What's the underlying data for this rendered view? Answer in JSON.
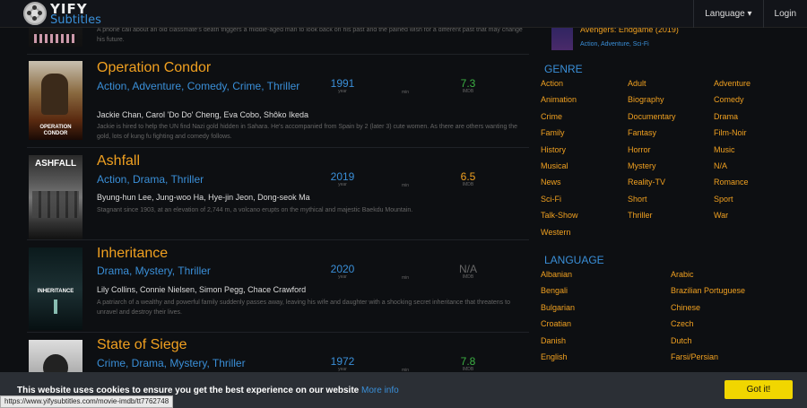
{
  "header": {
    "logo_line1": "YIFY",
    "logo_line2": "Subtitles",
    "nav": [
      "Language ▾",
      "Login"
    ]
  },
  "top_desc": "A phone call about an old classmate's death triggers a middle-aged man to look back on his past and the pained wish for a different past that may change his future.",
  "movies": [
    {
      "title": "Operation Condor",
      "genres": "Action, Adventure, Comedy, Crime, Thriller",
      "cast": "Jackie Chan, Carol 'Do Do' Cheng, Eva Cobo, Shôko Ikeda",
      "desc": "Jackie is hired to help the UN find Nazi gold hidden in Sahara. He's accompanied from Spain by 2 (later 3) cute women. As there are others wanting the gold, lots of kung fu fighting and comedy follows.",
      "year": "1991",
      "min": "",
      "imdb": "7.3",
      "poster_text": "OPERATION CONDOR",
      "imdb_color": "#3cb043"
    },
    {
      "title": "Ashfall",
      "genres": "Action, Drama, Thriller",
      "cast": "Byung-hun Lee, Jung-woo Ha, Hye-jin Jeon, Dong-seok Ma",
      "desc": "Stagnant since 1903, at an elevation of 2,744 m, a volcano erupts on the mythical and majestic Baekdu Mountain.",
      "year": "2019",
      "min": "",
      "imdb": "6.5",
      "poster_text": "ASHFALL",
      "imdb_color": "#f0a020"
    },
    {
      "title": "Inheritance",
      "genres": "Drama, Mystery, Thriller",
      "cast": "Lily Collins, Connie Nielsen, Simon Pegg, Chace Crawford",
      "desc": "A patriarch of a wealthy and powerful family suddenly passes away, leaving his wife and daughter with a shocking secret inheritance that threatens to unravel and destroy their lives.",
      "year": "2020",
      "min": "",
      "imdb": "N/A",
      "poster_text": "INHERITANCE",
      "imdb_color": "#666666"
    },
    {
      "title": "State of Siege",
      "genres": "Crime, Drama, Mystery, Thriller",
      "cast": "",
      "desc": "",
      "year": "1972",
      "min": "",
      "imdb": "7.8",
      "poster_text": "",
      "imdb_color": "#3cb043"
    }
  ],
  "stat_labels": {
    "year": "year",
    "min": "min",
    "imdb": "IMDB"
  },
  "sidebar": {
    "featured_title": "Avengers: Endgame (2019)",
    "featured_genres": "Action, Adventure, Sci-Fi",
    "genre_heading": "GENRE",
    "genres": [
      "Action",
      "Adult",
      "Adventure",
      "Animation",
      "Biography",
      "Comedy",
      "Crime",
      "Documentary",
      "Drama",
      "Family",
      "Fantasy",
      "Film-Noir",
      "History",
      "Horror",
      "Music",
      "Musical",
      "Mystery",
      "N/A",
      "News",
      "Reality-TV",
      "Romance",
      "Sci-Fi",
      "Short",
      "Sport",
      "Talk-Show",
      "Thriller",
      "War",
      "Western"
    ],
    "language_heading": "LANGUAGE",
    "languages": [
      "Albanian",
      "Arabic",
      "Bengali",
      "Brazilian Portuguese",
      "Bulgarian",
      "Chinese",
      "Croatian",
      "Czech",
      "Danish",
      "Dutch",
      "English",
      "Farsi/Persian"
    ]
  },
  "cookie": {
    "message": "This website uses cookies to ensure you get the best experience on our website",
    "more": "More info",
    "button": "Got it!"
  },
  "status_url": "https://www.yifysubtitles.com/movie-imdb/tt7762748"
}
